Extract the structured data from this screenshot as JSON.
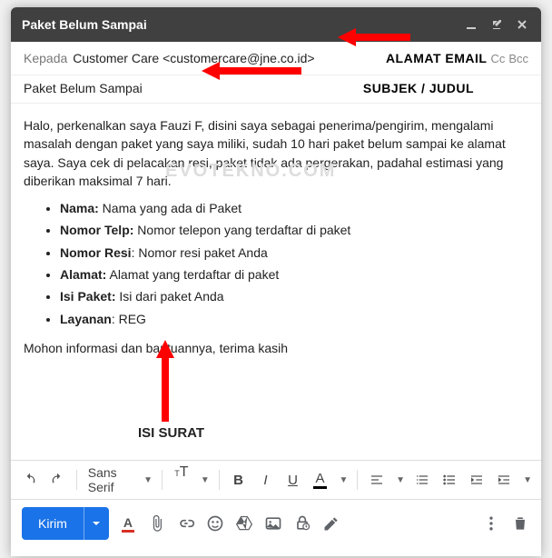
{
  "title": "Paket Belum Sampai",
  "to": {
    "label": "Kepada",
    "recipient": "Customer Care <customercare@jne.co.id>",
    "cc": "Cc",
    "bcc": "Bcc"
  },
  "annotations": {
    "email_addr": "ALAMAT EMAIL",
    "subject": "SUBJEK / JUDUL",
    "body": "ISI SURAT"
  },
  "subject": "Paket Belum Sampai",
  "watermark": "EVOTEKNO.COM",
  "body": {
    "intro": "Halo, perkenalkan saya Fauzi F, disini saya sebagai penerima/pengirim, mengalami masalah dengan paket yang saya miliki, sudah 10 hari paket belum sampai ke alamat saya. Saya cek di pelacakan resi, paket tidak ada pergerakan, padahal estimasi yang diberikan maksimal 7 hari.",
    "items": [
      {
        "label": "Nama:",
        "value": " Nama yang ada di Paket"
      },
      {
        "label": "Nomor Telp:",
        "value": " Nomor telepon yang terdaftar di paket"
      },
      {
        "label": "Nomor Resi",
        "value": ": Nomor resi paket Anda"
      },
      {
        "label": "Alamat:",
        "value": " Alamat yang terdaftar di paket"
      },
      {
        "label": "Isi Paket:",
        "value": " Isi dari paket Anda"
      },
      {
        "label": "Layanan",
        "value": ": REG"
      }
    ],
    "closing": "Mohon informasi dan bantuannya, terima kasih"
  },
  "toolbar": {
    "font": "Sans Serif"
  },
  "send": "Kirim"
}
